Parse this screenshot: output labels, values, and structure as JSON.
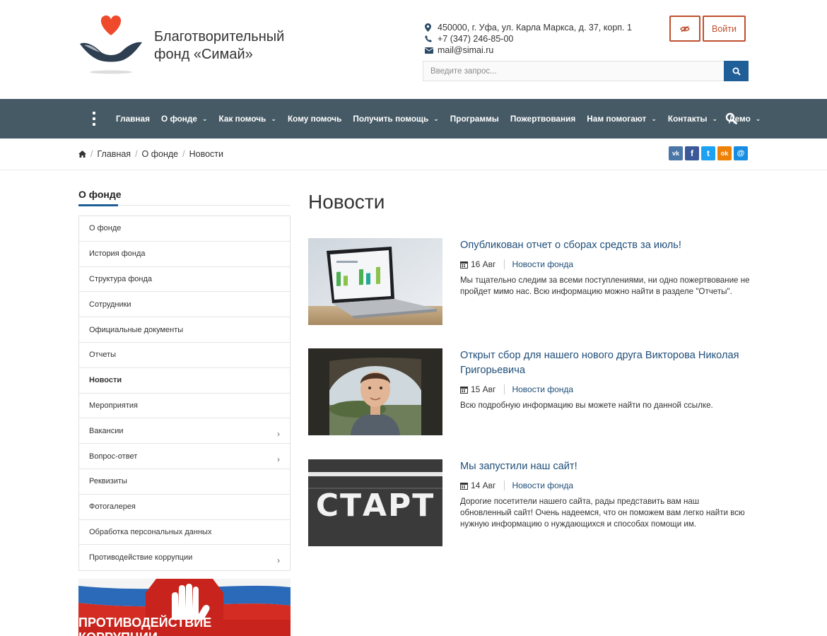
{
  "header": {
    "brand_line1": "Благотворительный",
    "brand_line2": "фонд «Симай»",
    "address": "450000, г. Уфа, ул. Карла Маркса, д. 37, корп. 1",
    "phone": "+7 (347) 246-85-00",
    "email": "mail@simai.ru",
    "login_label": "Войти",
    "search_placeholder": "Введите запрос..."
  },
  "nav": {
    "items": [
      {
        "label": "Главная",
        "dropdown": false
      },
      {
        "label": "О фонде",
        "dropdown": true
      },
      {
        "label": "Как помочь",
        "dropdown": true
      },
      {
        "label": "Кому помочь",
        "dropdown": false
      },
      {
        "label": "Получить помощь",
        "dropdown": true
      },
      {
        "label": "Программы",
        "dropdown": false
      },
      {
        "label": "Пожертвования",
        "dropdown": false
      },
      {
        "label": "Нам помогают",
        "dropdown": true
      },
      {
        "label": "Контакты",
        "dropdown": true
      },
      {
        "label": "Демо",
        "dropdown": true
      }
    ]
  },
  "breadcrumb": {
    "items": [
      "Главная",
      "О фонде",
      "Новости"
    ]
  },
  "social": [
    {
      "name": "vk",
      "label": "vk",
      "color": "#4a76a8"
    },
    {
      "name": "facebook",
      "label": "f",
      "color": "#3b5998"
    },
    {
      "name": "twitter",
      "label": "t",
      "color": "#1da1f2"
    },
    {
      "name": "odnoklassniki",
      "label": "ok",
      "color": "#ee8208"
    },
    {
      "name": "moimir",
      "label": "@",
      "color": "#168de2"
    }
  ],
  "sidebar": {
    "title": "О фонде",
    "items": [
      {
        "label": "О фонде",
        "active": false,
        "arrow": false
      },
      {
        "label": "История фонда",
        "active": false,
        "arrow": false
      },
      {
        "label": "Структура фонда",
        "active": false,
        "arrow": false
      },
      {
        "label": "Сотрудники",
        "active": false,
        "arrow": false
      },
      {
        "label": "Официальные документы",
        "active": false,
        "arrow": false
      },
      {
        "label": "Отчеты",
        "active": false,
        "arrow": false
      },
      {
        "label": "Новости",
        "active": true,
        "arrow": false
      },
      {
        "label": "Мероприятия",
        "active": false,
        "arrow": false
      },
      {
        "label": "Вакансии",
        "active": false,
        "arrow": true
      },
      {
        "label": "Вопрос-ответ",
        "active": false,
        "arrow": true
      },
      {
        "label": "Реквизиты",
        "active": false,
        "arrow": false
      },
      {
        "label": "Фотогалерея",
        "active": false,
        "arrow": false
      },
      {
        "label": "Обработка персональных данных",
        "active": false,
        "arrow": false
      },
      {
        "label": "Противодействие коррупции",
        "active": false,
        "arrow": true
      }
    ],
    "banner_text": "ПРОТИВОДЕЙСТВИЕ КОРРУПЦИИ"
  },
  "main": {
    "title": "Новости",
    "news": [
      {
        "title": "Опубликован отчет о сборах средств за июль!",
        "date": "16 Авг",
        "category": "Новости фонда",
        "text": "Мы тщательно следим за всеми поступлениями, ни одно пожертвование не пройдет мимо нас. Всю информацию можно найти в разделе \"Отчеты\"."
      },
      {
        "title": "Открыт сбор для нашего нового друга Викторова Николая Григорьевича",
        "date": "15 Авг",
        "category": "Новости фонда",
        "text": "Всю подробную информацию вы можете найти по данной ссылке."
      },
      {
        "title": "Мы запустили наш сайт!",
        "date": "14 Авг",
        "category": "Новости фонда",
        "text": "Дорогие посетители нашего сайта, рады представить вам наш обновленный сайт! Очень надеемся, что он поможем вам легко найти всю нужную информацию о нуждающихся и способах помощи им.",
        "image_text": "СТАРТ"
      }
    ]
  },
  "colors": {
    "nav_bg": "#465a66",
    "accent": "#1f5e97",
    "login_border": "#c0502f",
    "heart": "#ef4a2b",
    "link": "#1f4e79"
  }
}
